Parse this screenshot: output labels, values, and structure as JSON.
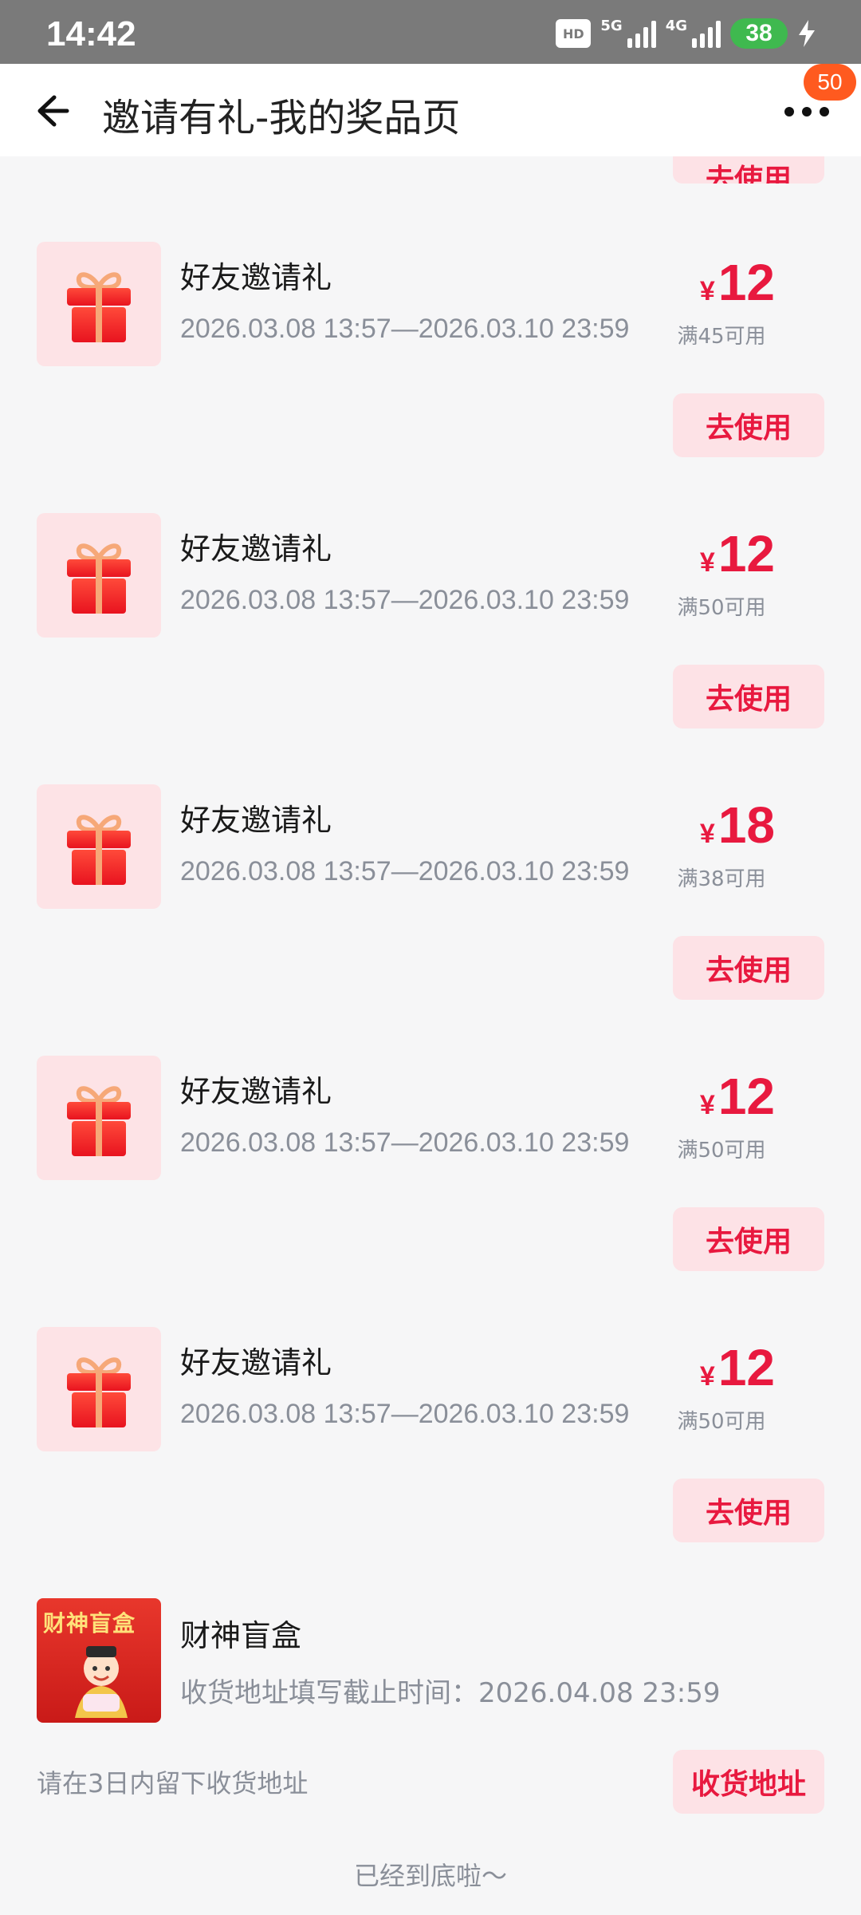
{
  "status_bar": {
    "time": "14:42",
    "hd": "HD",
    "net_5g": "5G",
    "net_4g": "4G",
    "battery": "38"
  },
  "header": {
    "title": "邀请有礼-我的奖品页",
    "badge_count": "50"
  },
  "partial_button_label": "去使用",
  "coupons": [
    {
      "name": "好友邀请礼",
      "period": "2026.03.08 13:57—2026.03.10 23:59",
      "currency": "¥",
      "amount": "12",
      "condition": "满45可用",
      "button": "去使用"
    },
    {
      "name": "好友邀请礼",
      "period": "2026.03.08 13:57—2026.03.10 23:59",
      "currency": "¥",
      "amount": "12",
      "condition": "满50可用",
      "button": "去使用"
    },
    {
      "name": "好友邀请礼",
      "period": "2026.03.08 13:57—2026.03.10 23:59",
      "currency": "¥",
      "amount": "18",
      "condition": "满38可用",
      "button": "去使用"
    },
    {
      "name": "好友邀请礼",
      "period": "2026.03.08 13:57—2026.03.10 23:59",
      "currency": "¥",
      "amount": "12",
      "condition": "满50可用",
      "button": "去使用"
    },
    {
      "name": "好友邀请礼",
      "period": "2026.03.08 13:57—2026.03.10 23:59",
      "currency": "¥",
      "amount": "12",
      "condition": "满50可用",
      "button": "去使用"
    }
  ],
  "blind_box": {
    "image_text": "财神盲盒",
    "name": "财神盲盒",
    "deadline": "收货地址填写截止时间：2026.04.08 23:59",
    "note": "请在3日内留下收货地址",
    "button": "收货地址"
  },
  "footer": "已经到底啦～",
  "colors": {
    "accent": "#e8193f",
    "button_bg": "#fde2e6",
    "badge": "#ff5a1f"
  }
}
